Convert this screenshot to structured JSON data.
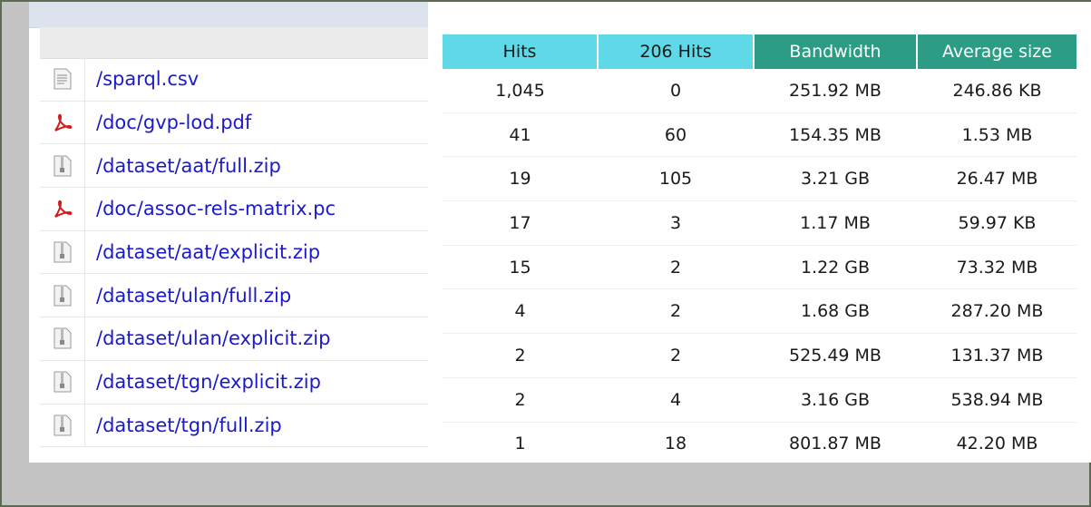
{
  "files": [
    {
      "icon": "text-file-icon",
      "path": "/sparql.csv"
    },
    {
      "icon": "pdf-file-icon",
      "path": "/doc/gvp-lod.pdf"
    },
    {
      "icon": "zip-file-icon",
      "path": "/dataset/aat/full.zip"
    },
    {
      "icon": "pdf-file-icon",
      "path": "/doc/assoc-rels-matrix.pc"
    },
    {
      "icon": "zip-file-icon",
      "path": "/dataset/aat/explicit.zip"
    },
    {
      "icon": "zip-file-icon",
      "path": "/dataset/ulan/full.zip"
    },
    {
      "icon": "zip-file-icon",
      "path": "/dataset/ulan/explicit.zip"
    },
    {
      "icon": "zip-file-icon",
      "path": "/dataset/tgn/explicit.zip"
    },
    {
      "icon": "zip-file-icon",
      "path": "/dataset/tgn/full.zip"
    }
  ],
  "table": {
    "headers": {
      "hits": "Hits",
      "hits206": "206 Hits",
      "bandwidth": "Bandwidth",
      "avg_size": "Average size"
    },
    "rows": [
      {
        "hits": "1,045",
        "hits206": "0",
        "bandwidth": "251.92 MB",
        "avg_size": "246.86 KB"
      },
      {
        "hits": "41",
        "hits206": "60",
        "bandwidth": "154.35 MB",
        "avg_size": "1.53 MB"
      },
      {
        "hits": "19",
        "hits206": "105",
        "bandwidth": "3.21 GB",
        "avg_size": "26.47 MB"
      },
      {
        "hits": "17",
        "hits206": "3",
        "bandwidth": "1.17 MB",
        "avg_size": "59.97 KB"
      },
      {
        "hits": "15",
        "hits206": "2",
        "bandwidth": "1.22 GB",
        "avg_size": "73.32 MB"
      },
      {
        "hits": "4",
        "hits206": "2",
        "bandwidth": "1.68 GB",
        "avg_size": "287.20 MB"
      },
      {
        "hits": "2",
        "hits206": "2",
        "bandwidth": "525.49 MB",
        "avg_size": "131.37 MB"
      },
      {
        "hits": "2",
        "hits206": "4",
        "bandwidth": "3.16 GB",
        "avg_size": "538.94 MB"
      },
      {
        "hits": "1",
        "hits206": "18",
        "bandwidth": "801.87 MB",
        "avg_size": "42.20 MB"
      }
    ]
  },
  "colors": {
    "hits_header": "#5fd8e8",
    "bandwidth_header": "#2c9c85",
    "link": "#1a1acc"
  }
}
